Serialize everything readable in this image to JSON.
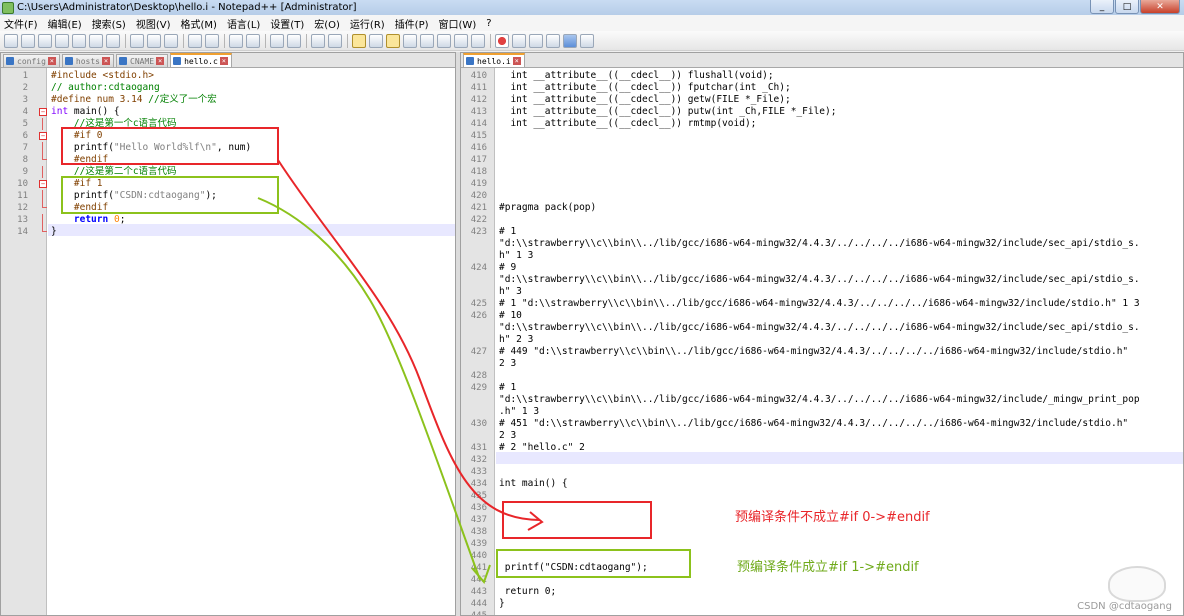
{
  "window": {
    "title": "C:\\Users\\Administrator\\Desktop\\hello.i - Notepad++ [Administrator]",
    "min": "_",
    "max": "□",
    "close": "✕"
  },
  "menu": [
    "文件(F)",
    "编辑(E)",
    "搜索(S)",
    "视图(V)",
    "格式(M)",
    "语言(L)",
    "设置(T)",
    "宏(O)",
    "运行(R)",
    "插件(P)",
    "窗口(W)",
    "?"
  ],
  "left_tabs": [
    {
      "label": "config",
      "active": false
    },
    {
      "label": "hosts",
      "active": false
    },
    {
      "label": "CNAME",
      "active": false
    },
    {
      "label": "hello.c",
      "active": true
    }
  ],
  "right_tabs": [
    {
      "label": "hello.i",
      "active": true
    }
  ],
  "left_lines": [
    {
      "n": "1",
      "fold": "",
      "html": "<span class='kw-pp'>#include &lt;stdio.h&gt;</span>"
    },
    {
      "n": "2",
      "fold": "",
      "html": "<span class='cmt'>// author:cdtaogang</span>"
    },
    {
      "n": "3",
      "fold": "",
      "html": "<span class='kw-pp'>#define num 3.14</span> <span class='cmt'>//定义了一个宏</span>"
    },
    {
      "n": "4",
      "fold": "box",
      "html": "<span class='kw-type'>int</span> main() {"
    },
    {
      "n": "5",
      "fold": "line",
      "html": "    <span class='cmt'>//这是第一个c语言代码</span>"
    },
    {
      "n": "6",
      "fold": "box",
      "html": "    <span class='kw-pp'>#if 0</span>"
    },
    {
      "n": "7",
      "fold": "line",
      "html": "    printf(<span class='str'>\"Hello World%lf\\n\"</span>, num)"
    },
    {
      "n": "8",
      "fold": "end",
      "html": "    <span class='kw-pp'>#endif</span>"
    },
    {
      "n": "9",
      "fold": "line",
      "html": "    <span class='cmt'>//这是第二个c语言代码</span>"
    },
    {
      "n": "10",
      "fold": "box",
      "html": "    <span class='kw-pp'>#if 1</span>"
    },
    {
      "n": "11",
      "fold": "line",
      "html": "    printf(<span class='str'>\"CSDN:cdtaogang\"</span>);"
    },
    {
      "n": "12",
      "fold": "end",
      "html": "    <span class='kw-pp'>#endif</span>"
    },
    {
      "n": "13",
      "fold": "line",
      "html": "    <span class='kw-blue'>return</span> <span class='num'>0</span>;"
    },
    {
      "n": "14",
      "fold": "end",
      "html": "}"
    }
  ],
  "right_lines": [
    {
      "n": "410",
      "text": "  int __attribute__((__cdecl__)) flushall(void);"
    },
    {
      "n": "411",
      "text": "  int __attribute__((__cdecl__)) fputchar(int _Ch);"
    },
    {
      "n": "412",
      "text": "  int __attribute__((__cdecl__)) getw(FILE *_File);"
    },
    {
      "n": "413",
      "text": "  int __attribute__((__cdecl__)) putw(int _Ch,FILE *_File);"
    },
    {
      "n": "414",
      "text": "  int __attribute__((__cdecl__)) rmtmp(void);"
    },
    {
      "n": "415",
      "text": ""
    },
    {
      "n": "416",
      "text": ""
    },
    {
      "n": "417",
      "text": ""
    },
    {
      "n": "418",
      "text": ""
    },
    {
      "n": "419",
      "text": ""
    },
    {
      "n": "420",
      "text": ""
    },
    {
      "n": "421",
      "text": "#pragma pack(pop)"
    },
    {
      "n": "422",
      "text": ""
    },
    {
      "n": "423",
      "text": "# 1"
    },
    {
      "n": "",
      "text": "\"d:\\\\strawberry\\\\c\\\\bin\\\\../lib/gcc/i686-w64-mingw32/4.4.3/../../../../i686-w64-mingw32/include/sec_api/stdio_s."
    },
    {
      "n": "",
      "text": "h\" 1 3"
    },
    {
      "n": "424",
      "text": "# 9"
    },
    {
      "n": "",
      "text": "\"d:\\\\strawberry\\\\c\\\\bin\\\\../lib/gcc/i686-w64-mingw32/4.4.3/../../../../i686-w64-mingw32/include/sec_api/stdio_s."
    },
    {
      "n": "",
      "text": "h\" 3"
    },
    {
      "n": "425",
      "text": "# 1 \"d:\\\\strawberry\\\\c\\\\bin\\\\../lib/gcc/i686-w64-mingw32/4.4.3/../../../../i686-w64-mingw32/include/stdio.h\" 1 3"
    },
    {
      "n": "426",
      "text": "# 10"
    },
    {
      "n": "",
      "text": "\"d:\\\\strawberry\\\\c\\\\bin\\\\../lib/gcc/i686-w64-mingw32/4.4.3/../../../../i686-w64-mingw32/include/sec_api/stdio_s."
    },
    {
      "n": "",
      "text": "h\" 2 3"
    },
    {
      "n": "427",
      "text": "# 449 \"d:\\\\strawberry\\\\c\\\\bin\\\\../lib/gcc/i686-w64-mingw32/4.4.3/../../../../i686-w64-mingw32/include/stdio.h\""
    },
    {
      "n": "",
      "text": "2 3"
    },
    {
      "n": "428",
      "text": ""
    },
    {
      "n": "429",
      "text": "# 1"
    },
    {
      "n": "",
      "text": "\"d:\\\\strawberry\\\\c\\\\bin\\\\../lib/gcc/i686-w64-mingw32/4.4.3/../../../../i686-w64-mingw32/include/_mingw_print_pop"
    },
    {
      "n": "",
      "text": ".h\" 1 3"
    },
    {
      "n": "430",
      "text": "# 451 \"d:\\\\strawberry\\\\c\\\\bin\\\\../lib/gcc/i686-w64-mingw32/4.4.3/../../../../i686-w64-mingw32/include/stdio.h\""
    },
    {
      "n": "",
      "text": "2 3"
    },
    {
      "n": "431",
      "text": "# 2 \"hello.c\" 2"
    },
    {
      "n": "432",
      "text": ""
    },
    {
      "n": "433",
      "text": ""
    },
    {
      "n": "434",
      "text": "int main() {"
    },
    {
      "n": "435",
      "text": ""
    },
    {
      "n": "436",
      "text": ""
    },
    {
      "n": "437",
      "text": ""
    },
    {
      "n": "438",
      "text": ""
    },
    {
      "n": "439",
      "text": ""
    },
    {
      "n": "440",
      "text": ""
    },
    {
      "n": "441",
      "text": " printf(\"CSDN:cdtaogang\");"
    },
    {
      "n": "442",
      "text": ""
    },
    {
      "n": "443",
      "text": " return 0;"
    },
    {
      "n": "444",
      "text": "}"
    },
    {
      "n": "445",
      "text": ""
    }
  ],
  "annotations": {
    "red_note": "预编译条件不成立#if 0->#endif",
    "green_note": "预编译条件成立#if 1->#endif",
    "red_color": "#e8262a",
    "green_color": "#8cc21c"
  },
  "watermark": "CSDN @cdtaogang"
}
